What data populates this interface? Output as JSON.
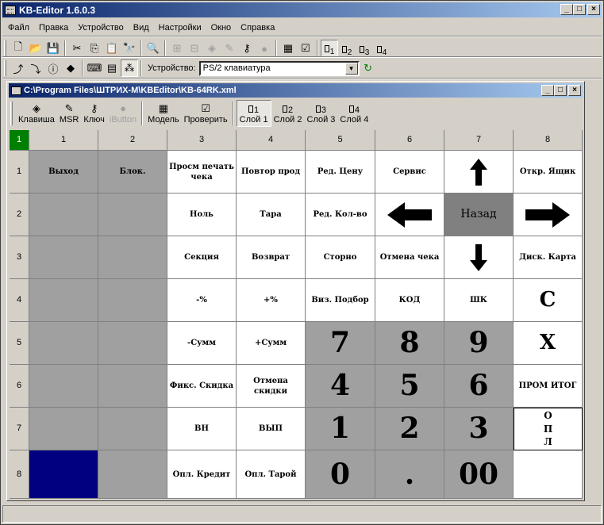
{
  "app": {
    "title": "KB-Editor 1.6.0.3"
  },
  "window_buttons": {
    "minimize": "_",
    "maximize": "□",
    "close": "×"
  },
  "menu": [
    "Файл",
    "Правка",
    "Устройство",
    "Вид",
    "Настройки",
    "Окно",
    "Справка"
  ],
  "toolbar1": {
    "icons": [
      "new-icon",
      "open-icon",
      "save-icon",
      "cut-icon",
      "copy-icon",
      "paste-icon",
      "find-icon",
      "preview-icon",
      "add-key-icon",
      "remove-key-icon",
      "cube-icon",
      "eraser-icon",
      "key-icon",
      "ibutton-icon",
      "model-icon",
      "check-icon"
    ],
    "layers": [
      {
        "label": "1"
      },
      {
        "label": "2"
      },
      {
        "label": "3"
      },
      {
        "label": "4"
      }
    ]
  },
  "toolbar2": {
    "device_label": "Устройство:",
    "device_value": "PS/2 клавиатура"
  },
  "child": {
    "title": "C:\\Program Files\\ШТРИХ-М\\KBEditor\\KB-64RK.xml",
    "tools": [
      {
        "label": "Клавиша",
        "icon": "cube-icon"
      },
      {
        "label": "MSR",
        "icon": "eraser-icon"
      },
      {
        "label": "Ключ",
        "icon": "key-icon"
      },
      {
        "label": "iButton",
        "icon": "ibutton-icon",
        "disabled": true
      }
    ],
    "model_tools": [
      {
        "label": "Модель",
        "icon": "model-icon"
      },
      {
        "label": "Проверить",
        "icon": "check-icon"
      }
    ],
    "layers": [
      {
        "label": "Слой 1",
        "num": "1",
        "active": true
      },
      {
        "label": "Слой 2",
        "num": "2"
      },
      {
        "label": "Слой 3",
        "num": "3"
      },
      {
        "label": "Слой 4",
        "num": "4"
      }
    ]
  },
  "grid": {
    "corner": "1",
    "columns": [
      "1",
      "2",
      "3",
      "4",
      "5",
      "6",
      "7",
      "8"
    ],
    "rows": [
      "1",
      "2",
      "3",
      "4",
      "5",
      "6",
      "7",
      "8"
    ],
    "cells": [
      [
        "Выход",
        "Блок.",
        "Просм печать чека",
        "Повтор прод",
        "Ред. Цену",
        "Сервис",
        "↑",
        "Откр. Ящик"
      ],
      [
        "",
        "",
        "Ноль",
        "Тара",
        "Ред. Кол-во",
        "←",
        "Назад",
        "→"
      ],
      [
        "",
        "",
        "Секция",
        "Возврат",
        "Сторно",
        "Отмена чека",
        "↓",
        "Диск. Карта"
      ],
      [
        "",
        "",
        "-%",
        "+%",
        "Виз. Подбор",
        "КОД",
        "ШК",
        "С"
      ],
      [
        "",
        "",
        "-Сумм",
        "+Сумм",
        "7",
        "8",
        "9",
        "Х"
      ],
      [
        "",
        "",
        "Фикс. Скидка",
        "Отмена скидки",
        "4",
        "5",
        "6",
        "ПРОМ ИТОГ"
      ],
      [
        "",
        "",
        "ВН",
        "ВЫП",
        "1",
        "2",
        "3",
        "О П Л"
      ],
      [
        "",
        "",
        "Опл. Кредит",
        "Опл. Тарой",
        "0",
        ".",
        "00",
        ""
      ]
    ]
  }
}
